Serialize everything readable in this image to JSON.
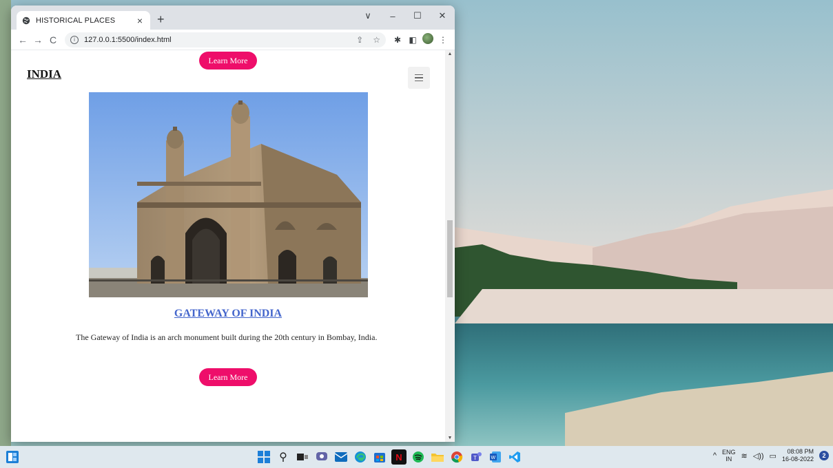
{
  "browser": {
    "tab_title": "HISTORICAL PLACES",
    "tab_close": "×",
    "new_tab": "+",
    "url": "127.0.0.1:5500/index.html",
    "window_controls": {
      "collapse": "∨",
      "minimize": "–",
      "maximize": "☐",
      "close": "✕"
    }
  },
  "page": {
    "brand": "INDIA",
    "top_button_label": "Learn More",
    "card": {
      "title": "GATEWAY OF INDIA",
      "description": "The Gateway of India is an arch monument built during the 20th century in Bombay, India.",
      "button_label": "Learn More"
    }
  },
  "taskbar": {
    "language": "ENG",
    "region": "IN",
    "time": "08:08 PM",
    "date": "16-08-2022",
    "notification_count": "2",
    "apps": [
      "start-icon",
      "search-icon",
      "file-explorer-icon",
      "chat-icon",
      "mail-icon",
      "edge-icon",
      "store-icon",
      "netflix-icon",
      "spotify-icon",
      "folder-icon",
      "chrome-icon",
      "teams-icon",
      "word-icon",
      "vscode-icon"
    ]
  },
  "colors": {
    "accent_button": "#ee0e6a",
    "link_title": "#4466cc"
  }
}
